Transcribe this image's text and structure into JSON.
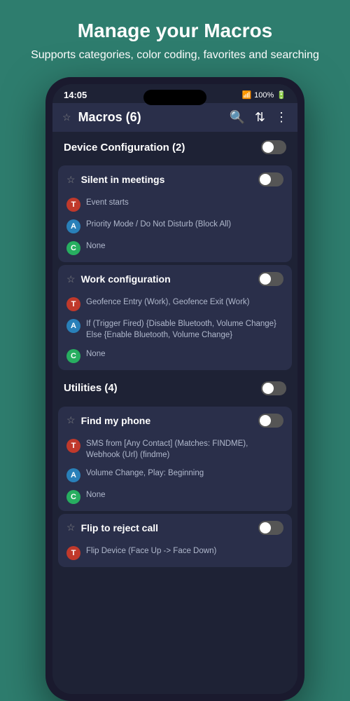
{
  "header": {
    "title": "Manage your Macros",
    "subtitle": "Supports categories, color coding, favorites and searching"
  },
  "statusBar": {
    "time": "14:05",
    "signal": "WiFi",
    "battery": "100%"
  },
  "appBar": {
    "title": "Macros (6)",
    "searchIcon": "🔍",
    "collapseIcon": "⇅",
    "menuIcon": "⋮"
  },
  "categories": [
    {
      "id": "device-config",
      "title": "Device Configuration (2)",
      "toggleOn": false,
      "macros": [
        {
          "id": "silent-meetings",
          "title": "Silent in meetings",
          "toggleOn": false,
          "trigger": "Event starts",
          "action": "Priority Mode / Do Not Disturb (Block All)",
          "condition": "None"
        },
        {
          "id": "work-configuration",
          "title": "Work configuration",
          "toggleOn": false,
          "trigger": "Geofence Entry (Work), Geofence Exit (Work)",
          "action": "If (Trigger Fired) {Disable Bluetooth, Volume Change} Else {Enable Bluetooth, Volume Change}",
          "condition": "None"
        }
      ]
    },
    {
      "id": "utilities",
      "title": "Utilities (4)",
      "toggleOn": false,
      "macros": [
        {
          "id": "find-my-phone",
          "title": "Find my phone",
          "toggleOn": false,
          "trigger": "SMS from [Any Contact] (Matches: FINDME), Webhook (Url) (findme)",
          "action": "Volume Change, Play: Beginning",
          "condition": "None"
        },
        {
          "id": "flip-to-reject",
          "title": "Flip to reject call",
          "toggleOn": false,
          "trigger": "Flip Device (Face Up -> Face Down)",
          "action": "",
          "condition": ""
        }
      ]
    }
  ]
}
